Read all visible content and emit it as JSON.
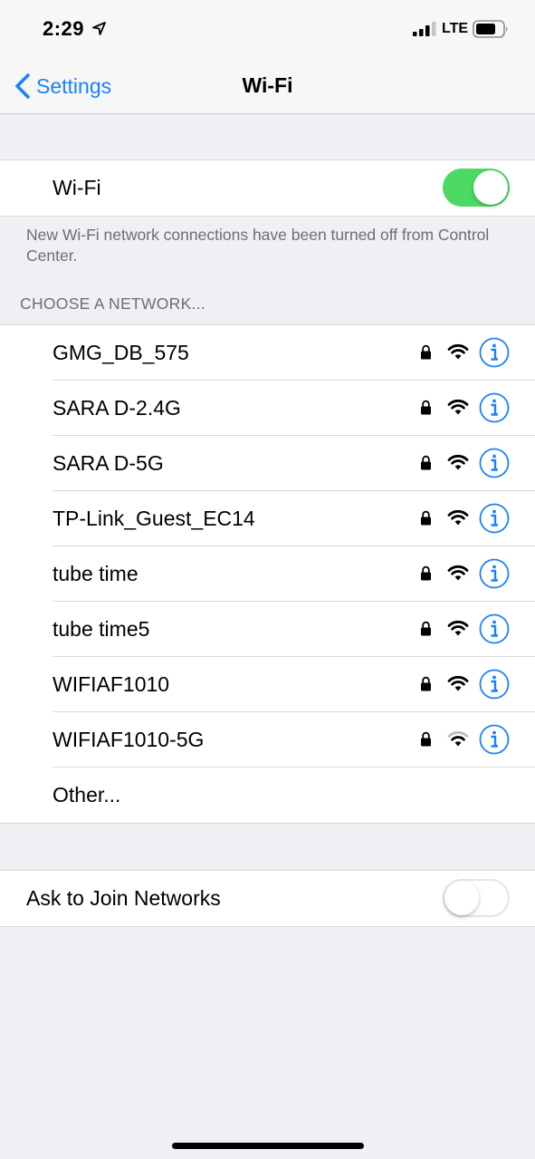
{
  "status_bar": {
    "time": "2:29",
    "carrier": "LTE"
  },
  "nav": {
    "back_label": "Settings",
    "title": "Wi-Fi"
  },
  "wifi_toggle": {
    "label": "Wi-Fi",
    "on": true
  },
  "wifi_note": "New Wi-Fi network connections have been turned off from Control Center.",
  "networks_header": "CHOOSE A NETWORK...",
  "networks": [
    {
      "name": "GMG_DB_575",
      "secured": true,
      "signal_bars": 3
    },
    {
      "name": "SARA D-2.4G",
      "secured": true,
      "signal_bars": 3
    },
    {
      "name": "SARA D-5G",
      "secured": true,
      "signal_bars": 3
    },
    {
      "name": "TP-Link_Guest_EC14",
      "secured": true,
      "signal_bars": 3
    },
    {
      "name": "tube time",
      "secured": true,
      "signal_bars": 3
    },
    {
      "name": "tube time5",
      "secured": true,
      "signal_bars": 3
    },
    {
      "name": "WIFIAF1010",
      "secured": true,
      "signal_bars": 3
    },
    {
      "name": "WIFIAF1010-5G",
      "secured": true,
      "signal_bars": 2
    }
  ],
  "other_label": "Other...",
  "ask_to_join": {
    "label": "Ask to Join Networks",
    "on": false
  },
  "colors": {
    "accent": "#1a82fb",
    "toggle_on": "#4cd964",
    "background": "#efeff4"
  }
}
